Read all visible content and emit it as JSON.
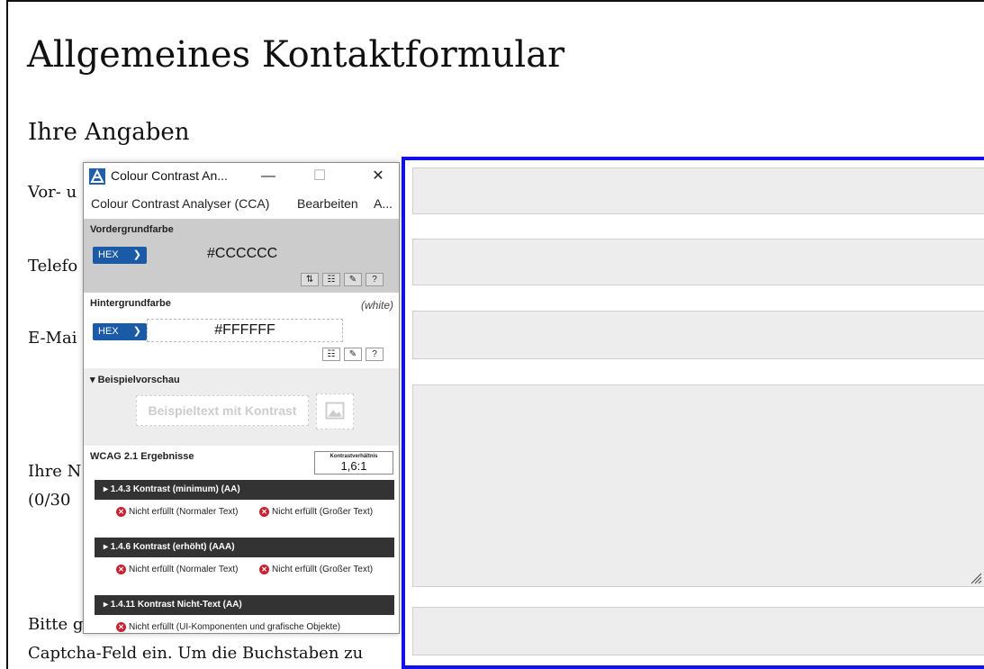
{
  "page": {
    "title": "Allgemeines Kontaktformular",
    "section_title": "Ihre Angaben",
    "labels": {
      "name": "Vor- u",
      "phone": "Telefo",
      "email": "E-Mai",
      "message_line1": "Ihre N",
      "message_line2": "(0/30",
      "captcha_line1": "Bitte g",
      "captcha_line2": "Captcha-Feld ein. Um die Buchstaben zu"
    }
  },
  "cca": {
    "window_title": "Colour Contrast An...",
    "window_controls": {
      "minimize": "—",
      "maximize": "☐",
      "close": "✕"
    },
    "menu": [
      "Colour Contrast Analyser (CCA)",
      "Bearbeiten",
      "A..."
    ],
    "foreground": {
      "label": "Vordergrundfarbe",
      "format": "HEX",
      "value": "#CCCCCC",
      "color": "#cccccc"
    },
    "background": {
      "label": "Hintergrundfarbe",
      "format": "HEX",
      "value": "#FFFFFF",
      "name_note": "(white)",
      "color": "#ffffff"
    },
    "preview": {
      "label": "▾ Beispielvorschau",
      "sample_text": "Beispieltext mit Kontrast"
    },
    "results": {
      "title": "WCAG 2.1 Ergebnisse",
      "ratio_label": "Kontrastverhältnis",
      "ratio_value": "1,6:1",
      "criteria": [
        {
          "label": "▸ 1.4.3 Kontrast (minimum) (AA)",
          "result_normal": "Nicht erfüllt (Normaler Text)",
          "result_large": "Nicht erfüllt (Großer Text)"
        },
        {
          "label": "▸ 1.4.6 Kontrast (erhöht) (AAA)",
          "result_normal": "Nicht erfüllt (Normaler Text)",
          "result_large": "Nicht erfüllt (Großer Text)"
        },
        {
          "label": "▸ 1.4.11 Kontrast Nicht-Text (AA)",
          "result_ui": "Nicht erfüllt (UI-Komponenten und grafische Objekte)"
        }
      ]
    }
  },
  "colors": {
    "focus_outline": "#1111ee",
    "input_bg": "#ededed",
    "hex_select": "#1a5aa6",
    "criterion_bar": "#333333",
    "fail": "#c8212f"
  }
}
